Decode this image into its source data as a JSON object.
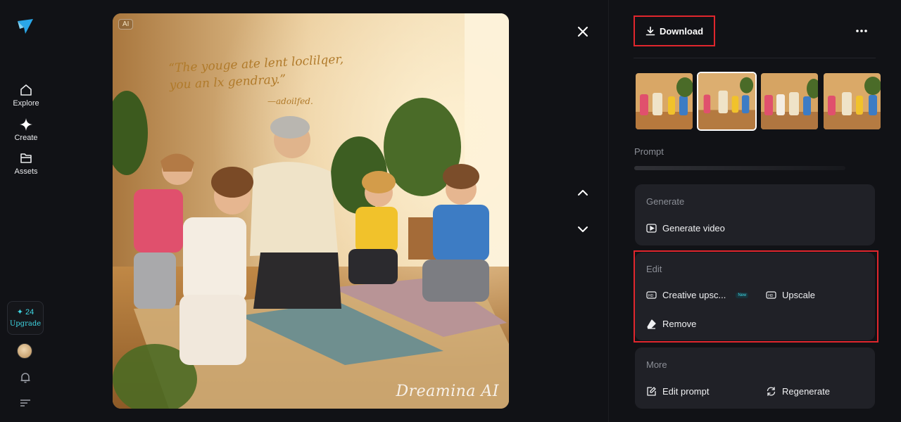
{
  "sidebar": {
    "items": [
      {
        "label": "Explore",
        "icon": "home-icon"
      },
      {
        "label": "Create",
        "icon": "sparkle-icon"
      },
      {
        "label": "Assets",
        "icon": "folder-icon"
      }
    ],
    "credits": "24",
    "upgrade_label": "Upgrade"
  },
  "image": {
    "ai_tag": "AI",
    "watermark": "Dreamina AI",
    "quote_line1": "“The youge ate lent loclilqer,",
    "quote_line2": "you an lx gendray.”",
    "quote_signature": "—adoilfed."
  },
  "toolbar": {
    "download_label": "Download"
  },
  "panel": {
    "prompt_label": "Prompt",
    "generate": {
      "title": "Generate",
      "generate_video": "Generate video"
    },
    "edit": {
      "title": "Edit",
      "creative_upscale": "Creative upsc...",
      "new_badge": "New",
      "upscale": "Upscale",
      "remove": "Remove"
    },
    "more": {
      "title": "More",
      "edit_prompt": "Edit prompt",
      "regenerate": "Regenerate"
    }
  },
  "colors": {
    "accent_cyan": "#3fd6e3",
    "highlight_red": "#e0262d",
    "card_bg": "#202127",
    "page_bg": "#111216"
  }
}
